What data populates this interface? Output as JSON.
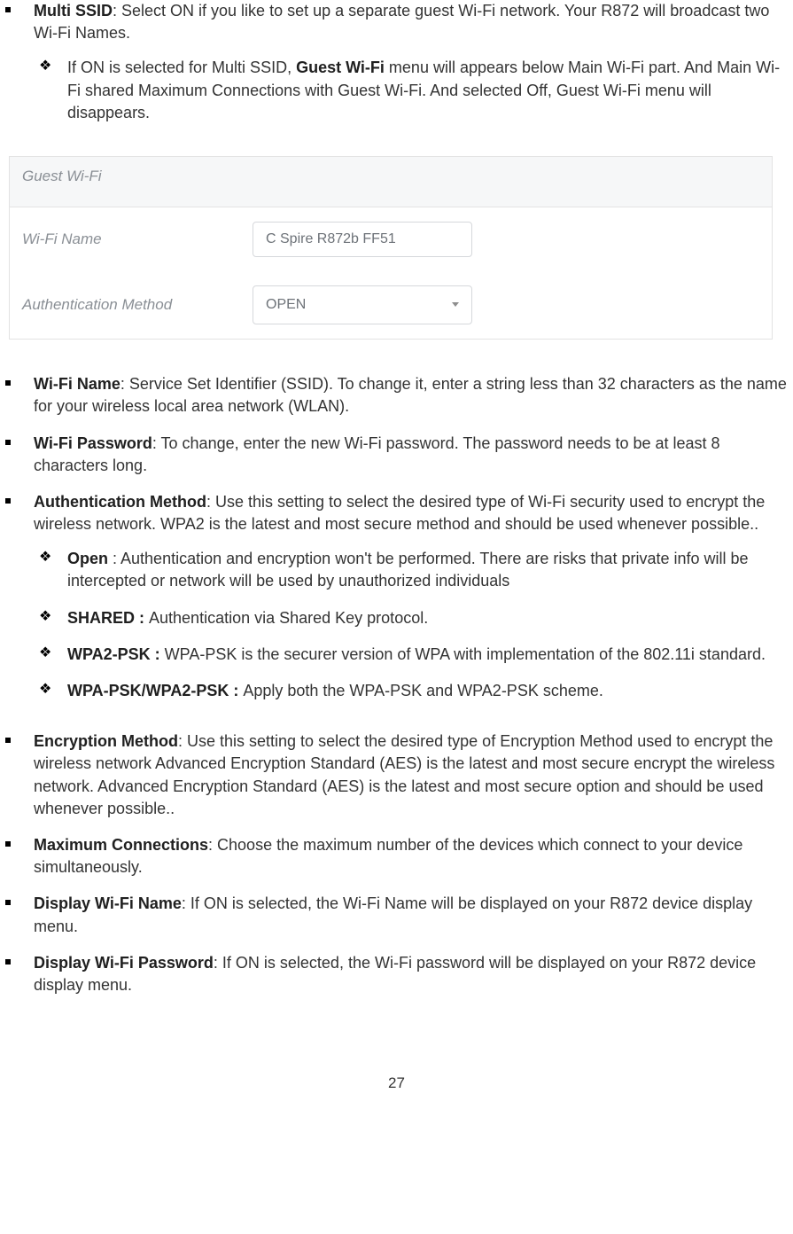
{
  "items": {
    "multi_ssid": {
      "title": "Multi SSID",
      "text": ": Select ON if you like to set up a separate guest Wi-Fi network. Your R872 will broadcast two Wi-Fi Names.",
      "sub1_a": "If ON is selected for Multi SSID, ",
      "sub1_bold": "Guest Wi-Fi",
      "sub1_b": " menu will appears below Main Wi-Fi part. And Main Wi-Fi shared Maximum Connections with Guest Wi-Fi. And selected Off, Guest Wi-Fi menu will disappears."
    },
    "shot": {
      "heading": "Guest Wi-Fi",
      "row1_label": "Wi-Fi Name",
      "row1_value": "C Spire R872b FF51",
      "row2_label": "Authentication Method",
      "row2_value": "OPEN"
    },
    "wifi_name": {
      "title": "Wi-Fi Name",
      "text": ": Service Set Identifier (SSID). To change it, enter a string less than 32 characters as the name for your wireless local area network (WLAN)."
    },
    "wifi_password": {
      "title": "Wi-Fi Password",
      "text": ": To change, enter the new Wi-Fi password. The password needs to be at least 8 characters long."
    },
    "auth_method": {
      "title": "Authentication Method",
      "text": ": Use this setting to select the desired type of Wi-Fi security used to encrypt the wireless network. WPA2 is the latest and most secure method and should be used whenever possible..",
      "open_title": "Open ",
      "open_text": ": Authentication and encryption won't be performed. There are risks that private info will be intercepted or network will be used by unauthorized individuals",
      "shared_title": "SHARED : ",
      "shared_text": "Authentication via Shared Key protocol.",
      "wpa2_title": "WPA2-PSK : ",
      "wpa2_text": "WPA-PSK is the securer version of WPA with implementation of the 802.11i standard.",
      "wpa_title": "WPA-PSK/WPA2-PSK : ",
      "wpa_text": "Apply both the WPA-PSK and WPA2-PSK scheme."
    },
    "encryption": {
      "title": "Encryption Method",
      "text": ": Use this setting to select the desired type of Encryption Method used to encrypt the wireless network Advanced Encryption Standard (AES) is the latest and most secure encrypt the wireless network. Advanced Encryption Standard (AES) is the latest and most secure option and should be used whenever possible.."
    },
    "max_conn": {
      "title": "Maximum Connections",
      "text": ": Choose the maximum number of the devices which connect to your device simultaneously."
    },
    "disp_name": {
      "title": "Display Wi-Fi Name",
      "text": ": If ON is selected, the Wi-Fi Name will be displayed on your R872 device display menu."
    },
    "disp_pw": {
      "title": "Display Wi-Fi Password",
      "text": ": If ON is selected, the Wi-Fi password will be displayed on your R872 device display menu."
    }
  },
  "page_number": "27"
}
